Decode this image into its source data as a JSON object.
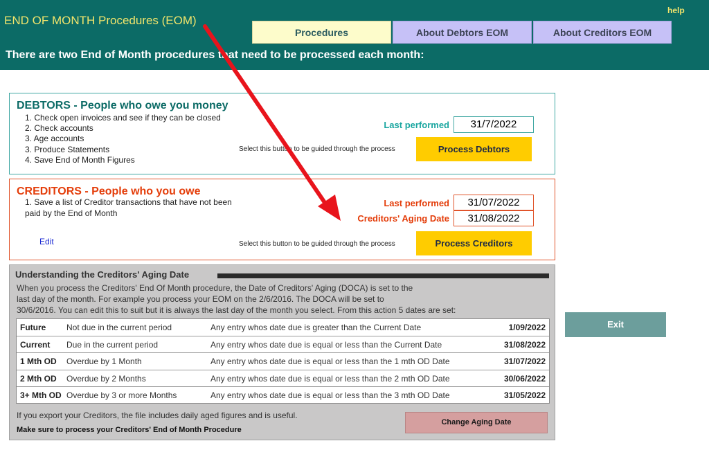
{
  "header": {
    "title": "END OF MONTH Procedures (EOM)",
    "help_label": "help",
    "tabs": [
      "Procedures",
      "About Debtors EOM",
      "About Creditors EOM"
    ],
    "intro": "There are two End of Month procedures that need to be processed each month:"
  },
  "debtors": {
    "heading": "DEBTORS - People who owe you money",
    "steps": [
      "1. Check open invoices and see if they can be closed",
      "2. Check accounts",
      "3. Age accounts",
      "3. Produce Statements",
      "4. Save End of Month Figures"
    ],
    "last_performed_label": "Last performed",
    "last_performed_value": "31/7/2022",
    "guide_text": "Select this button to be guided through the process",
    "button_label": "Process Debtors"
  },
  "creditors": {
    "heading": "CREDITORS - People who you owe",
    "step": "1. Save a list of Creditor transactions that have not been paid by the End of Month",
    "last_performed_label": "Last performed",
    "last_performed_value": "31/07/2022",
    "aging_date_label": "Creditors' Aging Date",
    "aging_date_value": "31/08/2022",
    "edit_label": "Edit",
    "guide_text": "Select this button to be guided through the process",
    "button_label": "Process Creditors"
  },
  "understanding": {
    "heading": "Understanding the Creditors' Aging Date",
    "paragraph_lines": [
      "When you process the Creditors' End Of Month procedure, the Date of Creditors' Aging (DOCA) is set to the",
      "last day of the month. For example you process your EOM on the 2/6/2016. The DOCA will be set to",
      "30/6/2016. You can edit this to suit but it is always the last day of the month you select. From this action 5 dates are set:"
    ],
    "rows": [
      {
        "period": "Future",
        "desc": "Not due in the current period",
        "rule": "Any entry whos date due is greater than the Current Date",
        "date": "1/09/2022"
      },
      {
        "period": "Current",
        "desc": "Due in the current period",
        "rule": "Any entry whos date due is equal or less than the Current Date",
        "date": "31/08/2022"
      },
      {
        "period": "1 Mth OD",
        "desc": "Overdue by 1 Month",
        "rule": "Any entry whos date due is equal or less than the 1 mth OD Date",
        "date": "31/07/2022"
      },
      {
        "period": "2 Mth OD",
        "desc": "Overdue by 2 Months",
        "rule": "Any entry whos date due is equal or less than the 2 mth OD Date",
        "date": "30/06/2022"
      },
      {
        "period": "3+ Mth OD",
        "desc": "Overdue by 3 or more Months",
        "rule": "Any entry whos date due is equal or less than the 3 mth OD Date",
        "date": "31/05/2022"
      }
    ],
    "footer_note": "If you export your Creditors, the file includes daily aged figures and is useful.",
    "footer_bold": "Make sure to process your Creditors' End of Month Procedure",
    "change_button_label": "Change Aging Date"
  },
  "exit_label": "Exit",
  "colors": {
    "header_bg": "#0c6b66",
    "title_yellow": "#f1e46b",
    "debtors_accent": "#0c6b66",
    "creditors_accent": "#e43d0a",
    "button_yellow": "#ffcc00",
    "annotation_arrow": "#e8141c"
  }
}
